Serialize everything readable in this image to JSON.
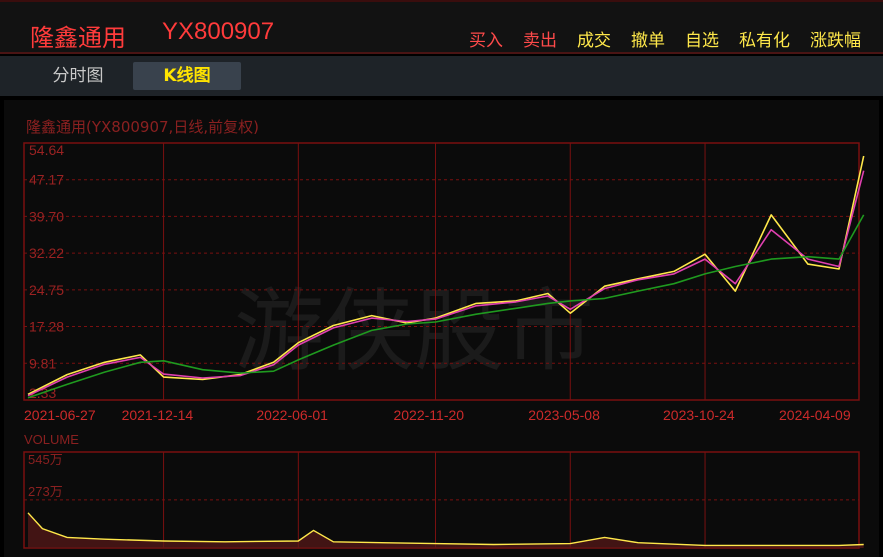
{
  "header": {
    "stock_name": "隆鑫通用",
    "stock_code": "YX800907",
    "actions": [
      "买入",
      "卖出",
      "成交",
      "撤单",
      "自选",
      "私有化",
      "涨跌幅"
    ]
  },
  "tabs": [
    {
      "label": "分时图",
      "active": false
    },
    {
      "label": "K线图",
      "active": true
    }
  ],
  "watermark": "游侠股市",
  "colors": {
    "accent_red": "#ff3b3b",
    "accent_yellow": "#ffe84a",
    "grid": "#7a1010",
    "ma_long": "#1f9a1f",
    "ma_pink": "#e040b0",
    "ma_yellow": "#ffe84a",
    "candle_up": "#ff3030",
    "candle_down": "#40d0d0"
  },
  "chart_data": {
    "type": "line",
    "caption": "隆鑫通用(YX800907,日线,前复权)",
    "price_labels": [
      "54.64",
      "47.17",
      "39.70",
      "32.22",
      "24.75",
      "17.28",
      "9.81",
      "2.33"
    ],
    "ylim": [
      2.33,
      54.64
    ],
    "x_dates": [
      "2021-06-27",
      "2021-12-14",
      "2022-06-01",
      "2022-11-20",
      "2023-05-08",
      "2023-10-24",
      "2024-04-09"
    ],
    "series": [
      {
        "color_key": "ma_yellow",
        "x": [
          "2021-06-27",
          "2021-08-15",
          "2021-10-01",
          "2021-11-15",
          "2021-12-14",
          "2022-02-01",
          "2022-03-20",
          "2022-05-01",
          "2022-06-01",
          "2022-07-15",
          "2022-09-01",
          "2022-10-15",
          "2022-11-20",
          "2023-01-10",
          "2023-03-01",
          "2023-04-10",
          "2023-05-08",
          "2023-06-20",
          "2023-08-01",
          "2023-09-15",
          "2023-10-24",
          "2023-12-01",
          "2024-01-15",
          "2024-03-01",
          "2024-04-09",
          "2024-05-10"
        ],
        "values": [
          3.5,
          7.5,
          10.0,
          11.5,
          7.0,
          6.5,
          7.5,
          10.0,
          14.0,
          17.5,
          19.5,
          18.0,
          19.0,
          22.0,
          22.5,
          24.0,
          20.0,
          25.5,
          27.0,
          28.5,
          32.0,
          24.5,
          40.0,
          30.0,
          29.0,
          52.0
        ]
      },
      {
        "color_key": "ma_pink",
        "x": [
          "2021-06-27",
          "2021-08-15",
          "2021-10-01",
          "2021-11-15",
          "2021-12-14",
          "2022-02-01",
          "2022-03-20",
          "2022-05-01",
          "2022-06-01",
          "2022-07-15",
          "2022-09-01",
          "2022-10-15",
          "2022-11-20",
          "2023-01-10",
          "2023-03-01",
          "2023-04-10",
          "2023-05-08",
          "2023-06-20",
          "2023-08-01",
          "2023-09-15",
          "2023-10-24",
          "2023-12-01",
          "2024-01-15",
          "2024-03-01",
          "2024-04-09",
          "2024-05-10"
        ],
        "values": [
          3.2,
          7.0,
          9.6,
          11.0,
          7.6,
          6.8,
          7.3,
          9.5,
          13.5,
          17.0,
          19.0,
          18.3,
          18.8,
          21.5,
          22.3,
          23.5,
          20.8,
          25.0,
          26.8,
          28.0,
          31.0,
          26.0,
          37.0,
          31.0,
          29.5,
          49.0
        ]
      },
      {
        "color_key": "ma_long",
        "x": [
          "2021-06-27",
          "2021-08-15",
          "2021-10-01",
          "2021-11-15",
          "2021-12-14",
          "2022-02-01",
          "2022-03-20",
          "2022-05-01",
          "2022-06-01",
          "2022-07-15",
          "2022-09-01",
          "2022-10-15",
          "2022-11-20",
          "2023-01-10",
          "2023-03-01",
          "2023-04-10",
          "2023-05-08",
          "2023-06-20",
          "2023-08-01",
          "2023-09-15",
          "2023-10-24",
          "2023-12-01",
          "2024-01-15",
          "2024-03-01",
          "2024-04-09",
          "2024-05-10"
        ],
        "values": [
          2.8,
          5.5,
          8.0,
          10.0,
          10.3,
          8.5,
          7.8,
          8.2,
          10.5,
          13.5,
          16.5,
          17.8,
          18.2,
          19.8,
          21.0,
          22.0,
          22.5,
          23.0,
          24.5,
          26.0,
          28.0,
          29.5,
          31.0,
          31.5,
          31.0,
          40.0
        ]
      }
    ],
    "volume": {
      "labels": [
        "VOLUME",
        "545万",
        "273万"
      ],
      "ylim": [
        0,
        545
      ],
      "x": [
        "2021-06-27",
        "2021-07-15",
        "2021-08-15",
        "2021-10-01",
        "2021-12-14",
        "2022-03-01",
        "2022-06-01",
        "2022-06-20",
        "2022-07-15",
        "2022-11-20",
        "2023-02-01",
        "2023-05-08",
        "2023-06-20",
        "2023-08-01",
        "2023-10-24",
        "2024-01-15",
        "2024-04-09",
        "2024-05-10"
      ],
      "values": [
        200,
        110,
        60,
        50,
        40,
        35,
        40,
        100,
        35,
        25,
        20,
        25,
        60,
        30,
        15,
        15,
        15,
        20
      ]
    }
  }
}
